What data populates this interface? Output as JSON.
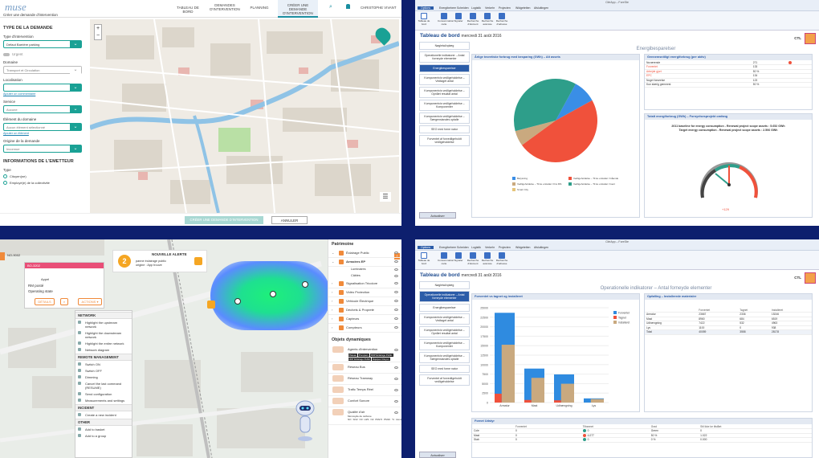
{
  "q1": {
    "logo": "muse",
    "logo_sub": "Créer une demande d'intervention",
    "nav": [
      "TABLEAU DE BORD",
      "DEMANDES D'INTERVENTION",
      "PLANNING",
      "CRÉER UNE DEMANDE D'INTERVENTION"
    ],
    "user": "CHRISTOPHE VIVANT",
    "page_sub": "Créer une demande d'intervention",
    "section_type": "TYPE DE LA DEMANDE",
    "label_type": "Type d'intervention",
    "value_type": "Défaut Barrière parking",
    "urgent": "Urgent",
    "label_domain": "Domaine",
    "value_domain": "Transport et Circulation",
    "label_location": "Localisation",
    "link_add1": "Ajouter un commentaire",
    "label_service": "Service",
    "value_service": "Aucune",
    "label_element": "Élément du domaine",
    "value_element": "Aucun élément sélectionné",
    "link_add2": "Ajouter un élément",
    "label_origin": "Origine de la demande",
    "value_origin": "Inconnue",
    "section_req": "INFORMATIONS DE L'EMETTEUR",
    "label_kind": "Type",
    "radio1": "Citoyen(ne)",
    "radio2": "Employé(e) de la collectivité",
    "btn_create": "CRÉER UNE DEMANDE D'INTERVENTION",
    "btn_cancel": "ANNULER"
  },
  "q2": {
    "title": "CitéApp – ForeSte",
    "tabs": [
      "Options",
      "Energibeheer",
      "Scheiden",
      "Logistik",
      "Verkehr",
      "Projecten",
      "Widgeteiten",
      "Afsluitingen"
    ],
    "ribbon": [
      "Tableau de bord",
      "Consommation carte",
      "Signaler",
      "Recherche d'élément",
      "Recherche avancée",
      "Recherche d'adresse"
    ],
    "ribbon_groups": [
      "Tableau de bord",
      "Cartographie",
      "Recherche"
    ],
    "dash_title": "Tableau de bord",
    "dash_date": "mercredi 31 août 2016",
    "ctl": "CTL",
    "sidebar": [
      "Nøgletal/oplæg",
      "Operationelle indikatorer – Antal forneyde elementer",
      "Energibesparelser",
      "Komponentvis vedligeholdelse – Vedtaget antal",
      "Komponentvis vedligeholdelse – Opnået resultat antal",
      "Komponentvis vedligeholdelse – Komponenter",
      "Komponentvis vedligeholdelse – Særgenstandes optalle",
      "SEO med forne natur",
      "Forventet af forvedligeholdt vedligeholdelse"
    ],
    "sidebar_active": 2,
    "update_btn": "Actualiser",
    "section": "Energibesparelser",
    "pie_panel": "Årlige teoretiske forbrug med besparing (GWh) – Alt assets",
    "table_panel": "Gennemsnitligt energiforbrug (per aktiv)",
    "table_rows": [
      [
        "Nuværende",
        "271",
        "●"
      ],
      [
        "Forventet",
        "133",
        ""
      ],
      [
        "Arbejde gjort",
        "50 %",
        ""
      ],
      [
        "EPC",
        "134",
        ""
      ],
      [
        "Noget forseelse",
        "123",
        ""
      ],
      [
        "Kun stærig gemmest",
        "50 %",
        ""
      ]
    ],
    "gauge_panel": "Totalt energiforbrug (GWh) – Fornyelsesprojekt omfang",
    "gauge_line1": "2011 baseline for energy consumption - Renewal project scope assets : 5.652 GWh",
    "gauge_line2": "Target energy consumption - Renewal project scope assets : 2.506 GWh",
    "gauge_delta": "+129",
    "pie_legend": [
      "Belysning",
      "Vedligeholdelse – Til ke erstattet I Gående",
      "Vedligeholdelse – Til ke erstattet I Fra MS",
      "Vedligeholdelse – Til ke erstattet I Gent",
      "Smart City"
    ],
    "colors": {
      "blue": "#3a8ee6",
      "red": "#f0513b",
      "teal": "#2e9e8a",
      "tan": "#c9a97f",
      "dark": "#1e4b8f"
    }
  },
  "q3": {
    "id": "NO-9002",
    "asset_id": "BO-3202",
    "asset_name": "RM posté",
    "asset_state": "Operating state",
    "asset_kind": "Appel",
    "btn_details": "DÉTAILS",
    "btn_actions": "ACTIONS ▾",
    "alert_num": "2",
    "alert_title": "NOUVELLE ALERTE",
    "alert_line1": "panne éclairage public",
    "alert_line2": "origine : App trouve",
    "menu": [
      {
        "h": "NETWORK",
        "items": [
          "Highlight the upstream network",
          "Highlight the downstream network",
          "Highlight the entire network",
          "Network diagram"
        ]
      },
      {
        "h": "REMOTE MANAGEMENT",
        "items": [
          "Switch ON",
          "Switch OFF",
          "Dimming",
          "Cancel the last command (RESUME)",
          "Send configuration",
          "Measurements and settings"
        ]
      },
      {
        "h": "INCIDENT",
        "items": [
          "Create a new incident"
        ]
      },
      {
        "h": "OTHER",
        "items": [
          "Add to basket",
          "Add to a group"
        ]
      }
    ],
    "side_title": "Patrimoine",
    "side_items": [
      "Éclairage Public",
      "Armoires EP",
      "Luminaires",
      "Câbles",
      "Signalisation Tricolore",
      "Vidéo Protection",
      "Véhicule Électrique",
      "Déchets & Propreté",
      "Capteurs",
      "Compteurs"
    ],
    "dyn_title": "Objets dynamiques",
    "dyn_items": [
      "Agents d'intervention",
      "Réseau Bus",
      "Réseau Tramway",
      "Trafic Temps Réel",
      "Confort Sonore",
      "Qualité d'air"
    ],
    "tags": [
      "Plateau",
      "Pompiers",
      "DDP Éclairage Public",
      "DDP Éclairage Public",
      "Équipes Citoyen"
    ],
    "air": [
      "NO",
      "SO2",
      "O3",
      "H2S",
      "O2",
      "PM2.5",
      "PM10",
      "°C",
      "Humidité",
      "Pression"
    ],
    "air_sub": "Monoxyde de carbone"
  },
  "q4": {
    "title": "CitéApp – ForeSte",
    "dash_title": "Tableau de bord",
    "dash_date": "mercredi 31 août 2016",
    "ctl": "CTL",
    "section": "Operationelle indikatorer – Antal forneyde elementer",
    "sidebar": [
      "Nøgletal/oplæg",
      "Operationelle indikatorer – Antal forneyde elementer",
      "Energibesparelser",
      "Komponentvis vedligeholdelse – Vedtaget antal",
      "Komponentvis vedligeholdelse – Opnået resultat antal",
      "Komponentvis vedligeholdelse – Komponenter",
      "Komponentvis vedligeholdelse – Særgenstandes optalle",
      "SEO med forne natur",
      "Forventet af forvedligeholdt vedligeholdelse"
    ],
    "sidebar_active": 1,
    "update_btn": "Actualiser",
    "chart_panel": "Forventet vs tagnet og installeret",
    "table_panel": "Opfølling – Installerede materialer",
    "legend": [
      "Forventet",
      "Tagnet",
      "Installeret"
    ],
    "table_head": [
      "",
      "Forventet",
      "Tagnet",
      "Installeret"
    ],
    "table_rows": [
      [
        "Armatur",
        "23667",
        "2336",
        "15246"
      ],
      [
        "Mast",
        "8960",
        "684",
        "6519"
      ],
      [
        "Udhængning",
        "7422",
        "532",
        "4963"
      ],
      [
        "Lys",
        "1100",
        "0",
        "938"
      ],
      [
        "Total",
        "40059",
        "3558",
        "28178"
      ]
    ],
    "bottom_panel": "Fornet Udstyr",
    "bottom_head": [
      "",
      "Forventet",
      "Tilbannet",
      "Grad",
      "Stil ikke ke tilstået"
    ],
    "bottom_rows": [
      [
        "Cole",
        "0",
        "0",
        "Green",
        "0"
      ],
      [
        "Mast",
        "0",
        "4,077",
        "50 %",
        "1.022"
      ],
      [
        "Stab",
        "0",
        "0",
        "0 %",
        "0.000"
      ]
    ],
    "chart_data": {
      "type": "bar",
      "categories": [
        "Armatur",
        "Mast",
        "Udhængning",
        "Lys"
      ],
      "series": [
        {
          "name": "Forventet",
          "values": [
            23667,
            8960,
            7422,
            1100
          ]
        },
        {
          "name": "Tagnet",
          "values": [
            2336,
            684,
            532,
            0
          ]
        },
        {
          "name": "Installeret",
          "values": [
            15246,
            6519,
            4963,
            938
          ]
        }
      ],
      "colors": [
        "#2f8be0",
        "#f0513b",
        "#c9a97f"
      ],
      "ylim": [
        0,
        25000
      ],
      "yticks": [
        0,
        2500,
        5000,
        7500,
        10000,
        12500,
        15000,
        17500,
        20000,
        22500,
        25000
      ]
    }
  },
  "pie_data": {
    "type": "pie",
    "labels": [
      "Belysning",
      "Vedligeholdelse – Til ke erstattet I Gående",
      "Vedligeholdelse – Til ke erstattet I Fra MS",
      "Vedligeholdelse – Til ke erstattet I Gent",
      "Smart City"
    ],
    "values": [
      9,
      48,
      6,
      37,
      0
    ],
    "colors": [
      "#3a8ee6",
      "#f0513b",
      "#c9a97f",
      "#2e9e8a",
      "#e5c47b"
    ]
  }
}
